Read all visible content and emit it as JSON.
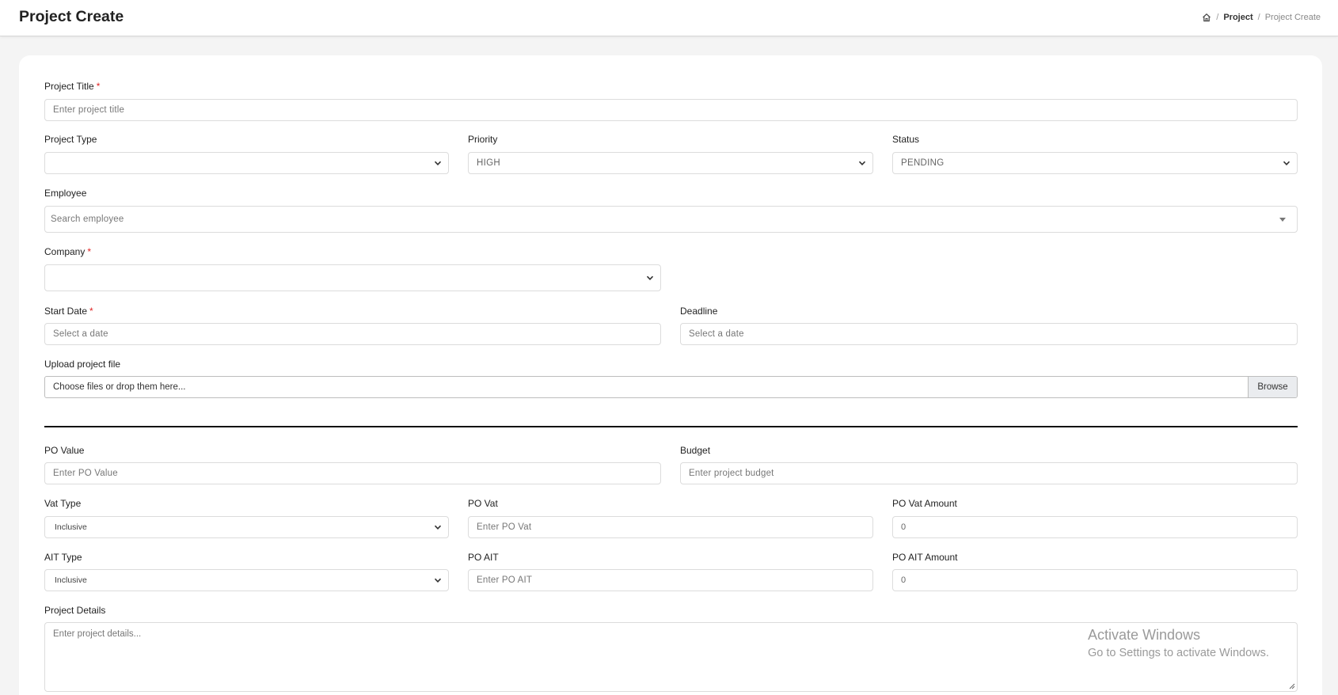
{
  "header": {
    "title": "Project Create",
    "breadcrumb": {
      "parent": "Project",
      "separator": "/",
      "current": "Project Create"
    }
  },
  "form": {
    "project_title": {
      "label": "Project Title",
      "required": "*",
      "placeholder": "Enter project title"
    },
    "project_type": {
      "label": "Project Type",
      "value": ""
    },
    "priority": {
      "label": "Priority",
      "value": "HIGH"
    },
    "status": {
      "label": "Status",
      "value": "PENDING"
    },
    "employee": {
      "label": "Employee",
      "placeholder": "Search employee"
    },
    "company": {
      "label": "Company",
      "required": "*",
      "value": ""
    },
    "start_date": {
      "label": "Start Date",
      "required": "*",
      "placeholder": "Select a date"
    },
    "deadline": {
      "label": "Deadline",
      "placeholder": "Select a date"
    },
    "upload": {
      "label": "Upload project file",
      "placeholder": "Choose files or drop them here...",
      "button": "Browse"
    },
    "po_value": {
      "label": "PO Value",
      "placeholder": "Enter PO Value"
    },
    "budget": {
      "label": "Budget",
      "placeholder": "Enter project budget"
    },
    "vat_type": {
      "label": "Vat Type",
      "value": "Inclusive"
    },
    "po_vat": {
      "label": "PO Vat",
      "placeholder": "Enter PO Vat"
    },
    "po_vat_amount": {
      "label": "PO Vat Amount",
      "value": "0"
    },
    "ait_type": {
      "label": "AIT Type",
      "value": "Inclusive"
    },
    "po_ait": {
      "label": "PO AIT",
      "placeholder": "Enter PO AIT"
    },
    "po_ait_amount": {
      "label": "PO AIT Amount",
      "value": "0"
    },
    "project_details": {
      "label": "Project Details",
      "placeholder": "Enter project details..."
    }
  },
  "watermark": {
    "line1": "Activate Windows",
    "line2": "Go to Settings to activate Windows."
  },
  "colors": {
    "required": "#e02424",
    "divider": "#111111",
    "background": "#f4f4f4"
  }
}
